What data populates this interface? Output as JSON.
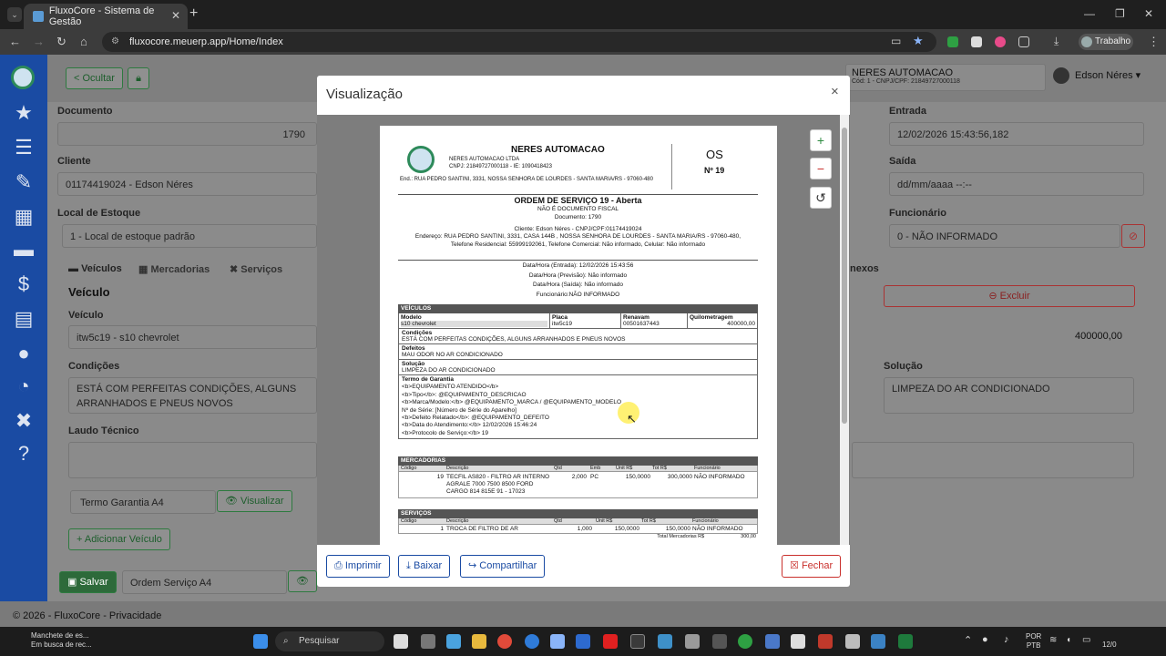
{
  "browser": {
    "tab_title": "FluxoCore - Sistema de Gestão",
    "url": "fluxocore.meuerp.app/Home/Index",
    "profile": "Trabalho"
  },
  "topbar": {
    "hide_label": "< Ocultar",
    "company_name": "NERES AUTOMACAO",
    "company_sub": "Cód: 1 - CNPJ/CPF: 21849727000118",
    "user_name": "Edson Néres"
  },
  "form": {
    "documento_label": "Documento",
    "documento_value": "1790",
    "cliente_label": "Cliente",
    "cliente_value": "01174419024 - Edson Néres",
    "estoque_label": "Local de Estoque",
    "estoque_value": "1 - Local de estoque padrão",
    "tabs": [
      "Veículos",
      "Mercadorias",
      "Serviços"
    ],
    "veiculo_heading": "Veículo",
    "veiculo_label": "Veículo",
    "veiculo_value": "itw5c19 - s10 chevrolet",
    "condicoes_label": "Condições",
    "condicoes_value": "ESTÁ COM PERFEITAS CONDIÇÕES, ALGUNS ARRANHADOS E PNEUS NOVOS",
    "laudo_label": "Laudo Técnico",
    "termo_select": "Termo Garantia A4",
    "visualizar": "Visualizar",
    "add_veiculo": "Adicionar Veículo",
    "salvar": "Salvar",
    "ordem_select": "Ordem Serviço A4",
    "entrada_label": "Entrada",
    "entrada_value": "12/02/2026 15:43:56,182",
    "saida_label": "Saída",
    "saida_value": "dd/mm/aaaa --:--",
    "funcionario_label": "Funcionário",
    "funcionario_value": "0 - NÃO INFORMADO",
    "anexos_label": "nexos",
    "excluir": "Excluir",
    "km_value": "400000,00",
    "solucao_label": "Solução",
    "solucao_value": "LIMPEZA DO AR CONDICIONADO"
  },
  "footer": "© 2026 - FluxoCore - Privacidade",
  "modal": {
    "title": "Visualização",
    "buttons": {
      "imprimir": "Imprimir",
      "baixar": "Baixar",
      "compartilhar": "Compartilhar",
      "fechar": "Fechar"
    }
  },
  "doc": {
    "company": "NERES AUTOMACAO",
    "company_legal": "NERES AUTOMACAO LTDA",
    "company_ids": "CNPJ: 21849727000118 - IE: 1090418423",
    "company_addr": "End.: RUA PEDRO SANTINI, 3331, NOSSA SENHORA DE LOURDES - SANTA MARIA/RS - 97060-480",
    "os_label": "OS",
    "os_number": "Nº 19",
    "title": "ORDEM DE SERVIÇO 19 - Aberta",
    "fiscal": "NÃO É DOCUMENTO FISCAL",
    "documento": "Documento: 1790",
    "cliente": "Cliente: Edson Néres - CNPJ/CPF:01174419024",
    "endereco": "Endereço: RUA PEDRO SANTINI, 3331, CASA 144B , NOSSA SENHORA DE LOURDES - SANTA MARIA/RS - 97060-480,",
    "telefone": "Telefone Residencial: 55999192061, Telefone Comercial: Não informado, Celular: Não informado",
    "entrada": "Data/Hora (Entrada): 12/02/2026 15:43:56",
    "previsao": "Data/Hora (Previsão): Não informado",
    "saida": "Data/Hora (Saída): Não informado",
    "funcionario": "Funcionário:NÃO INFORMADO",
    "veiculos_header": "VEÍCULOS",
    "vh": [
      "Modelo",
      "Placa",
      "Renavam",
      "Quilometragem"
    ],
    "vv": [
      "s10 chevrolet",
      "itw5c19",
      "00501637443",
      "400000,00"
    ],
    "condicoes_h": "Condições",
    "condicoes": "ESTÁ COM PERFEITAS CONDIÇÕES, ALGUNS ARRANHADOS E PNEUS NOVOS",
    "defeitos_h": "Defeitos",
    "defeitos": "MAU ODOR NO AR CONDICIONADO",
    "solucao_h": "Solução",
    "solucao": "LIMPEZA DO AR CONDICIONADO",
    "termo_h": "Termo de Garantia",
    "termo_lines": [
      "<b>EQUIPAMENTO ATENDIDO</b>",
      "<b>Tipo</b>: @EQUIPAMENTO_DESCRICAO",
      "<b>Marca/Modelo:</b> @EQUIPAMENTO_MARCA / @EQUIPAMENTO_MODELO",
      "Nº de Série: [Número de Série do Aparelho]",
      "<b>Defeito Relatado</b>: @EQUIPAMENTO_DEFEITO",
      "<b>Data do Atendimento:</b> 12/02/2026 15:46:24",
      "<b>Protocolo de Serviço:</b> 19"
    ],
    "mercadorias_header": "MERCADORIAS",
    "mh": [
      "Código",
      "Descrição",
      "Qtd",
      "Emb",
      "Unit R$",
      "Tot R$",
      "Funcionário"
    ],
    "mv": [
      "19",
      "TECFIL AS820 - FILTRO AR INTERNO AGRALE 7000 7500 8500 FORD CARGO 814 815E 91 - 17023",
      "2,000",
      "PC",
      "150,0000",
      "300,0000",
      "NÃO INFORMADO"
    ],
    "servicos_header": "SERVIÇOS",
    "sh": [
      "Código",
      "Descrição",
      "Qtd",
      "Unit R$",
      "Tot R$",
      "Funcionário"
    ],
    "sv": [
      "1",
      "TROCA DE FILTRO DE AR",
      "1,000",
      "150,0000",
      "150,0000",
      "NÃO INFORMADO"
    ],
    "total_label": "Total Mercadorias R$",
    "total_value": "300,00"
  },
  "taskbar": {
    "news_title": "Manchete de es...",
    "news_sub": "Em busca de rec...",
    "search": "Pesquisar",
    "lang": "POR",
    "lang2": "PTB",
    "date": "12/0"
  }
}
